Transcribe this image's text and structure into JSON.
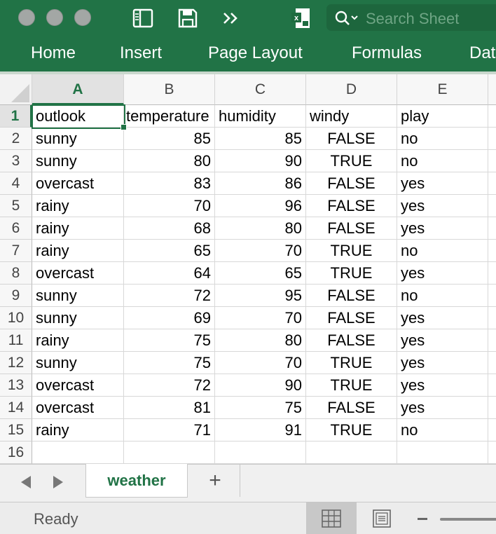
{
  "toolbar": {
    "search_placeholder": "Search Sheet",
    "icons": [
      "sidebar-toggle-icon",
      "save-icon",
      "more-chevrons-icon",
      "excel-file-icon"
    ]
  },
  "ribbon": {
    "tabs": [
      "Home",
      "Insert",
      "Page Layout",
      "Formulas",
      "Dat"
    ]
  },
  "sheet": {
    "columns": [
      "A",
      "B",
      "C",
      "D",
      "E"
    ],
    "rows": [
      "1",
      "2",
      "3",
      "4",
      "5",
      "6",
      "7",
      "8",
      "9",
      "10",
      "11",
      "12",
      "13",
      "14",
      "15",
      "16"
    ],
    "active_cell": "A1",
    "headers": [
      "outlook",
      "temperature",
      "humidity",
      "windy",
      "play"
    ],
    "records": [
      [
        "sunny",
        "85",
        "85",
        "FALSE",
        "no"
      ],
      [
        "sunny",
        "80",
        "90",
        "TRUE",
        "no"
      ],
      [
        "overcast",
        "83",
        "86",
        "FALSE",
        "yes"
      ],
      [
        "rainy",
        "70",
        "96",
        "FALSE",
        "yes"
      ],
      [
        "rainy",
        "68",
        "80",
        "FALSE",
        "yes"
      ],
      [
        "rainy",
        "65",
        "70",
        "TRUE",
        "no"
      ],
      [
        "overcast",
        "64",
        "65",
        "TRUE",
        "yes"
      ],
      [
        "sunny",
        "72",
        "95",
        "FALSE",
        "no"
      ],
      [
        "sunny",
        "69",
        "70",
        "FALSE",
        "yes"
      ],
      [
        "rainy",
        "75",
        "80",
        "FALSE",
        "yes"
      ],
      [
        "sunny",
        "75",
        "70",
        "TRUE",
        "yes"
      ],
      [
        "overcast",
        "72",
        "90",
        "TRUE",
        "yes"
      ],
      [
        "overcast",
        "81",
        "75",
        "FALSE",
        "yes"
      ],
      [
        "rainy",
        "71",
        "91",
        "TRUE",
        "no"
      ]
    ]
  },
  "sheet_tabs": {
    "active": "weather",
    "add_label": "+"
  },
  "status": {
    "text": "Ready"
  },
  "colors": {
    "brand": "#217346",
    "ribbon": "#217346"
  }
}
